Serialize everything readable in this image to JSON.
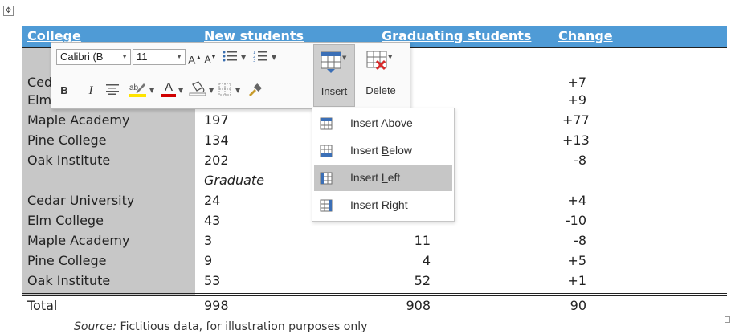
{
  "table": {
    "headers": [
      "College",
      "New students",
      "Graduating students",
      "Change"
    ],
    "rows": [
      {
        "name": "Cedar University",
        "new": "",
        "grad": "",
        "change": "+7"
      },
      {
        "name": "Elm College",
        "new": "",
        "grad": "",
        "change": "+9"
      },
      {
        "name": "Maple Academy",
        "new": "197",
        "grad": "",
        "change": "+77"
      },
      {
        "name": "Pine College",
        "new": "134",
        "grad": "",
        "change": "+13"
      },
      {
        "name": "Oak Institute",
        "new": "202",
        "grad": "",
        "change": "-8"
      },
      {
        "name": "",
        "new": "Graduate",
        "grad": "",
        "change": ""
      },
      {
        "name": "Cedar University",
        "new": "24",
        "grad": "",
        "change": "+4"
      },
      {
        "name": "Elm College",
        "new": "43",
        "grad": "",
        "change": "-10"
      },
      {
        "name": "Maple Academy",
        "new": "3",
        "grad": "11",
        "change": "-8"
      },
      {
        "name": "Pine College",
        "new": "9",
        "grad": "4",
        "change": "+5"
      },
      {
        "name": "Oak Institute",
        "new": "53",
        "grad": "52",
        "change": "+1"
      }
    ],
    "total": {
      "name": "Total",
      "new": "998",
      "grad": "908",
      "change": "90"
    }
  },
  "source": {
    "label": "Source:",
    "text": " Fictitious data, for illustration purposes only"
  },
  "mini_toolbar": {
    "font_name": "Calibri (B",
    "font_size": "11",
    "grow_font": "A",
    "shrink_font": "A",
    "bold": "B",
    "italic": "I",
    "font_color_letter": "A",
    "insert_label": "Insert",
    "delete_label": "Delete"
  },
  "insert_menu": {
    "above": {
      "pre": "Insert ",
      "u": "A",
      "post": "bove"
    },
    "below": {
      "pre": "Insert ",
      "u": "B",
      "post": "elow"
    },
    "left": {
      "pre": "Insert ",
      "u": "L",
      "post": "eft"
    },
    "right": {
      "pre": "Inse",
      "u": "r",
      "post": "t Right"
    }
  },
  "colors": {
    "header_band": "#4f9bd6",
    "gray_column": "#c7c7c7",
    "highlight": "#c6c6c6",
    "font_color_red": "#d00000",
    "highlight_yellow": "#ffe400"
  }
}
